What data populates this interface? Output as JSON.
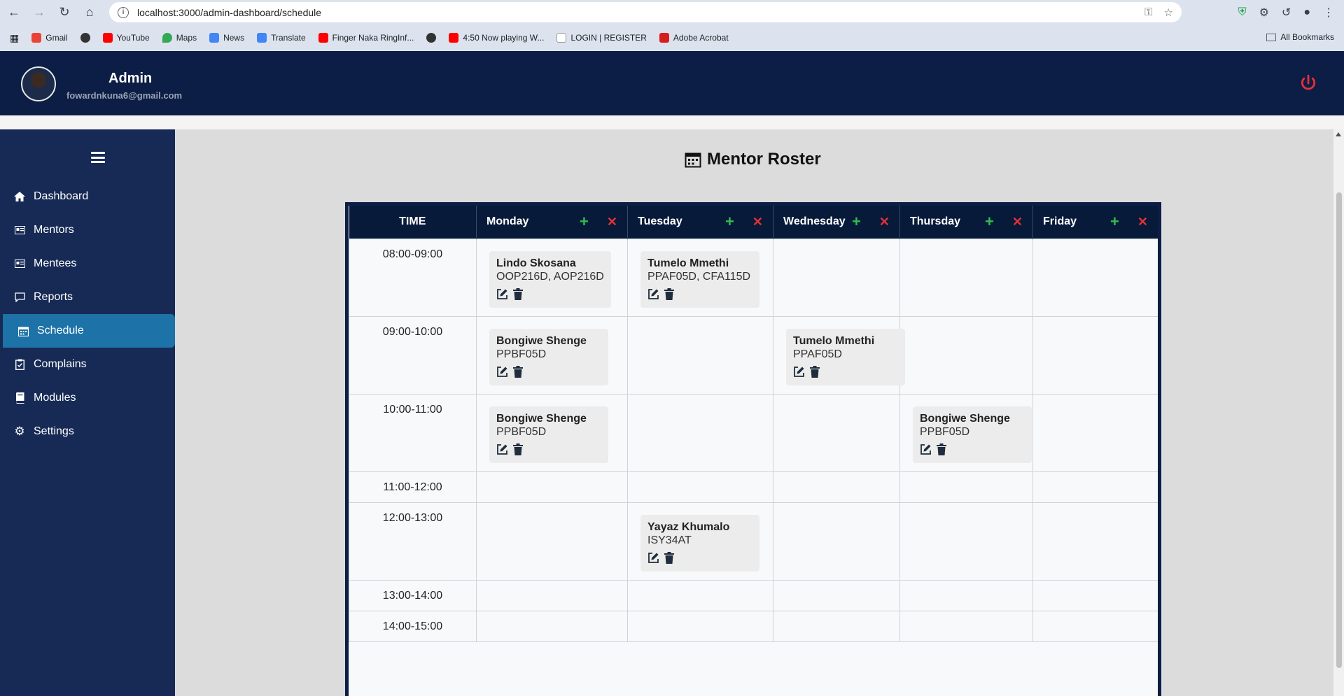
{
  "browser": {
    "url": "localhost:3000/admin-dashboard/schedule",
    "bookmarks": [
      "Gmail",
      "YouTube",
      "Maps",
      "News",
      "Translate",
      "Finger Naka RingInf...",
      "4:50 Now playing W...",
      "LOGIN | REGISTER",
      "Adobe Acrobat"
    ],
    "all_bookmarks": "All Bookmarks"
  },
  "header": {
    "name": "Admin",
    "email": "fowardnkuna6@gmail.com"
  },
  "sidebar": {
    "items": [
      {
        "label": "Dashboard",
        "icon": "home-icon"
      },
      {
        "label": "Mentors",
        "icon": "id-card-icon"
      },
      {
        "label": "Mentees",
        "icon": "id-card-icon"
      },
      {
        "label": "Reports",
        "icon": "comment-icon"
      },
      {
        "label": "Schedule",
        "icon": "calendar-icon",
        "active": true
      },
      {
        "label": "Complains",
        "icon": "clipboard-icon"
      },
      {
        "label": "Modules",
        "icon": "book-icon"
      },
      {
        "label": "Settings",
        "icon": "gear-icon"
      }
    ]
  },
  "page": {
    "title": "Mentor Roster"
  },
  "roster": {
    "time_header": "TIME",
    "days": [
      "Monday",
      "Tuesday",
      "Wednesday",
      "Thursday",
      "Friday"
    ],
    "rows": [
      {
        "time": "08:00-09:00",
        "cells": [
          {
            "name": "Lindo Skosana",
            "codes": "OOP216D, AOP216D"
          },
          {
            "name": "Tumelo Mmethi",
            "codes": "PPAF05D, CFA115D"
          },
          null,
          null,
          null
        ]
      },
      {
        "time": "09:00-10:00",
        "cells": [
          {
            "name": "Bongiwe Shenge",
            "codes": "PPBF05D"
          },
          null,
          {
            "name": "Tumelo Mmethi",
            "codes": "PPAF05D"
          },
          null,
          null
        ]
      },
      {
        "time": "10:00-11:00",
        "cells": [
          {
            "name": "Bongiwe Shenge",
            "codes": "PPBF05D"
          },
          null,
          null,
          {
            "name": "Bongiwe Shenge",
            "codes": "PPBF05D"
          },
          null
        ]
      },
      {
        "time": "11:00-12:00",
        "cells": [
          null,
          null,
          null,
          null,
          null
        ]
      },
      {
        "time": "12:00-13:00",
        "cells": [
          null,
          {
            "name": "Yayaz Khumalo",
            "codes": "ISY34AT"
          },
          null,
          null,
          null
        ]
      },
      {
        "time": "13:00-14:00",
        "cells": [
          null,
          null,
          null,
          null,
          null
        ]
      },
      {
        "time": "14:00-15:00",
        "cells": [
          null,
          null,
          null,
          null,
          null
        ]
      }
    ]
  },
  "colors": {
    "header_bg": "#0c1e45",
    "sidebar_bg": "#162a55",
    "active_item": "#1d72a8",
    "add": "#2fbf4a",
    "remove": "#e5303a",
    "power": "#e5303a"
  }
}
